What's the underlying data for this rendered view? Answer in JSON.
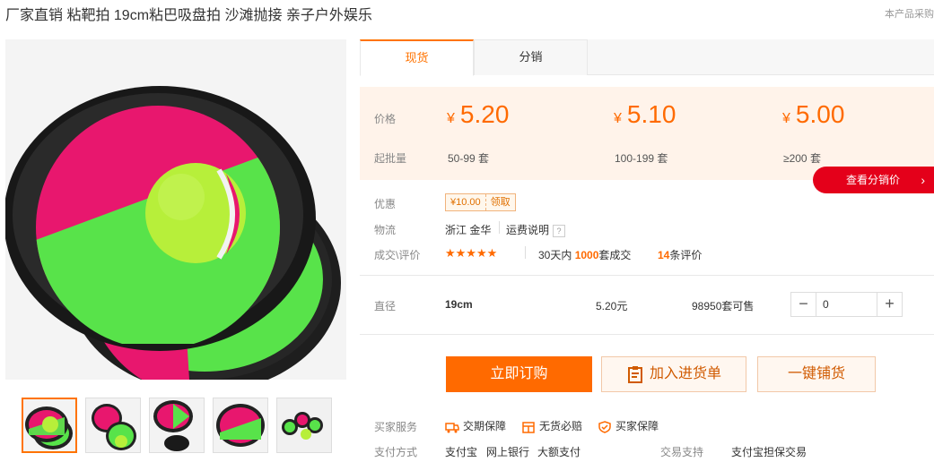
{
  "title": "厂家直销 粘靶拍 19cm粘巴吸盘拍 沙滩抛接 亲子户外娱乐",
  "report_link": "本产品采购",
  "tabs": [
    "现货",
    "分销"
  ],
  "price_label": "价格",
  "batch_label": "起批量",
  "currency_symbol": "¥",
  "tiers": [
    {
      "price": "5.20",
      "qty": "50-99 套"
    },
    {
      "price": "5.10",
      "qty": "100-199 套"
    },
    {
      "price": "5.00",
      "qty": "≥200 套"
    }
  ],
  "dist_button": "查看分销价",
  "promo": {
    "label": "优惠",
    "coupon_value": "¥10.00",
    "coupon_action": "领取"
  },
  "logistics": {
    "label": "物流",
    "origin": "浙江 金华",
    "shipping_link": "运费说明",
    "help": "?"
  },
  "deals": {
    "label": "成交\\评价",
    "stars": "★★★★★",
    "period": "30天内",
    "count": "1000",
    "count_unit": "套成交",
    "reviews": "14",
    "reviews_unit": "条评价"
  },
  "sku": {
    "label": "直径",
    "value": "19cm",
    "price": "5.20元",
    "stock": "98950套可售",
    "quantity": "0",
    "minus": "−",
    "plus": "+"
  },
  "buttons": {
    "buy": "立即订购",
    "cart": "加入进货单",
    "dropship": "一键铺货"
  },
  "services": {
    "label": "买家服务",
    "items": [
      "交期保障",
      "无货必赔",
      "买家保障"
    ]
  },
  "payment": {
    "label": "支付方式",
    "methods": [
      "支付宝",
      "网上银行",
      "大额支付"
    ],
    "trade_label": "交易支持",
    "trade_value": "支付宝担保交易"
  },
  "colors": {
    "accent": "#ff6a00",
    "dist_red": "#e4001a",
    "pink": "#e8176e",
    "green": "#58e34a"
  }
}
